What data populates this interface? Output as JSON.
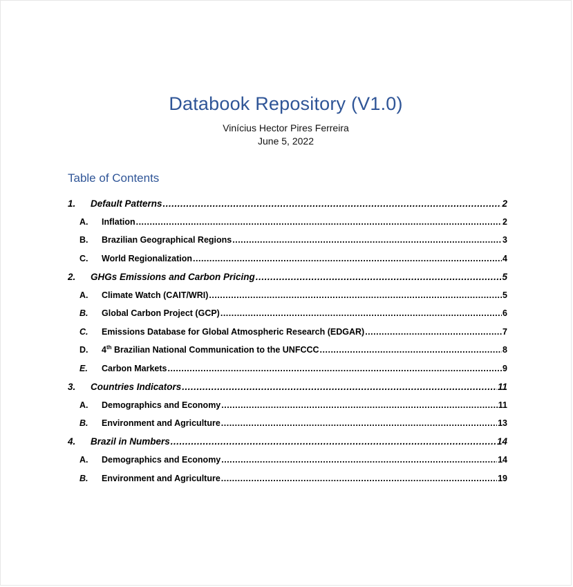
{
  "document": {
    "title": "Databook Repository (V1.0)",
    "author": "Vinícius Hector Pires Ferreira",
    "date": "June 5, 2022"
  },
  "toc": {
    "heading": "Table of Contents",
    "sections": [
      {
        "num": "1.",
        "label": "Default Patterns",
        "page": "2",
        "items": [
          {
            "num": "A.",
            "label": "Inflation",
            "page": "2"
          },
          {
            "num": "B.",
            "label": "Brazilian Geographical Regions",
            "page": "3"
          },
          {
            "num": "C.",
            "label": "World Regionalization",
            "page": "4"
          }
        ]
      },
      {
        "num": "2.",
        "label": "GHGs Emissions and Carbon Pricing",
        "page": "5",
        "items": [
          {
            "num": "A.",
            "label": "Climate Watch (CAIT/WRI)",
            "page": "5"
          },
          {
            "num": "B.",
            "label": "Global Carbon Project (GCP)",
            "page": "6"
          },
          {
            "num": "C.",
            "label": "Emissions Database for Global Atmospheric Research (EDGAR)",
            "page": "7"
          },
          {
            "num": "D.",
            "label_prefix": "4",
            "label_sup": "th",
            "label": "Brazilian National Communication to the UNFCCC",
            "page": "8"
          },
          {
            "num": "E.",
            "label": "Carbon Markets",
            "page": "9"
          }
        ]
      },
      {
        "num": "3.",
        "label": "Countries Indicators",
        "page": "11",
        "items": [
          {
            "num": "A.",
            "label": "Demographics and Economy",
            "page": "11"
          },
          {
            "num": "B.",
            "label": "Environment and Agriculture",
            "page": "13"
          }
        ]
      },
      {
        "num": "4.",
        "label": "Brazil in Numbers",
        "page": "14",
        "items": [
          {
            "num": "A.",
            "label": "Demographics and Economy",
            "page": "14"
          },
          {
            "num": "B.",
            "label": "Environment and Agriculture",
            "page": "19"
          }
        ]
      }
    ]
  }
}
